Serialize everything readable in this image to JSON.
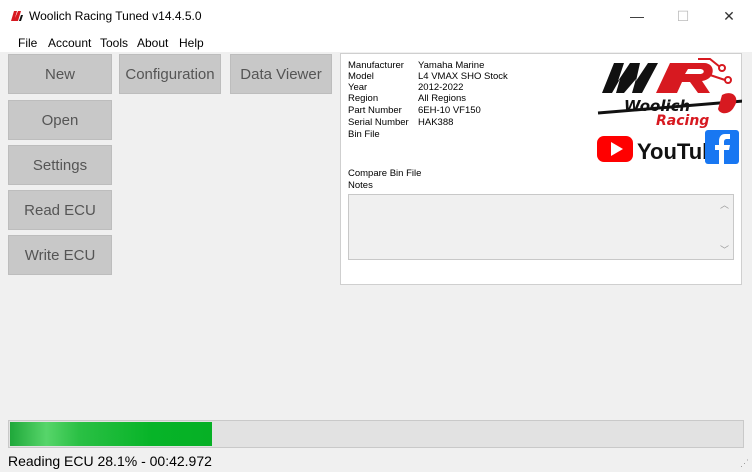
{
  "window": {
    "title": "Woolich Racing Tuned v14.4.5.0",
    "minimize": "—",
    "maximize": "☐",
    "close": "✕"
  },
  "menu": {
    "items": [
      "File",
      "Account",
      "Tools",
      "About",
      "Help"
    ]
  },
  "buttons": {
    "new": "New",
    "configuration": "Configuration",
    "data_viewer": "Data Viewer",
    "open": "Open",
    "settings": "Settings",
    "read_ecu": "Read ECU",
    "write_ecu": "Write ECU"
  },
  "info": {
    "rows": [
      {
        "key": "Manufacturer",
        "value": "Yamaha Marine"
      },
      {
        "key": "Model",
        "value": "L4 VMAX SHO Stock"
      },
      {
        "key": "Year",
        "value": "2012-2022"
      },
      {
        "key": "Region",
        "value": "All Regions"
      },
      {
        "key": "Part Number",
        "value": "6EH-10 VF150"
      },
      {
        "key": "Serial Number",
        "value": "HAK388"
      },
      {
        "key": "Bin File",
        "value": ""
      }
    ],
    "compare_bin_label": "Compare Bin File",
    "notes_label": "Notes",
    "notes_value": ""
  },
  "logos": {
    "brand_letters": "WR",
    "brand_name": "Woolich Racing",
    "youtube": "YouTube",
    "facebook": "f"
  },
  "progress": {
    "fraction": 0.281
  },
  "status": {
    "text": "Reading ECU 28.1% - 00:42.972"
  },
  "colors": {
    "progress": "#06b025",
    "brand_red": "#d71920",
    "youtube_red": "#ff0000",
    "facebook_blue": "#1877f2"
  }
}
